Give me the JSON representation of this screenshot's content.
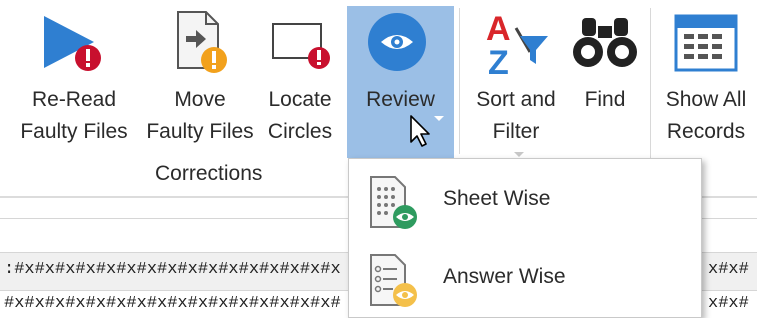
{
  "ribbon": {
    "buttons": [
      {
        "id": "reread",
        "line1": "Re-Read",
        "line2": "Faulty Files",
        "icon": "play-error-icon"
      },
      {
        "id": "move",
        "line1": "Move",
        "line2": "Faulty Files",
        "icon": "document-warning-icon"
      },
      {
        "id": "locate",
        "line1": "Locate",
        "line2": "Circles",
        "icon": "rectangle-error-icon"
      },
      {
        "id": "review",
        "line1": "Review",
        "line2": "",
        "icon": "eye-icon"
      },
      {
        "id": "sort",
        "line1": "Sort and",
        "line2": "Filter",
        "icon": "sort-filter-icon"
      },
      {
        "id": "find",
        "line1": "Find",
        "line2": "",
        "icon": "binoculars-icon"
      },
      {
        "id": "showall",
        "line1": "Show All",
        "line2": "Records",
        "icon": "table-icon"
      }
    ],
    "group_label": "Corrections"
  },
  "grid": {
    "row1_left": ":#x#x#x#x#x#x#x#x#x#x#x#x#x#x#x#x",
    "row1_right": "x#x#",
    "row2_left": "#x#x#x#x#x#x#x#x#x#x#x#x#x#x#x#x#",
    "row2_right": "x#x#"
  },
  "menu": {
    "items": [
      {
        "label": "Sheet Wise",
        "icon": "sheet-eye-icon"
      },
      {
        "label": "Answer Wise",
        "icon": "list-eye-icon"
      }
    ]
  },
  "colors": {
    "accent_blue": "#2f7fd1",
    "selected_bg": "#9bbfe6",
    "error_red": "#c8102e",
    "warning_orange": "#f2a11c",
    "eye_green": "#2e9b5f",
    "eye_yellow": "#f4c04a"
  }
}
